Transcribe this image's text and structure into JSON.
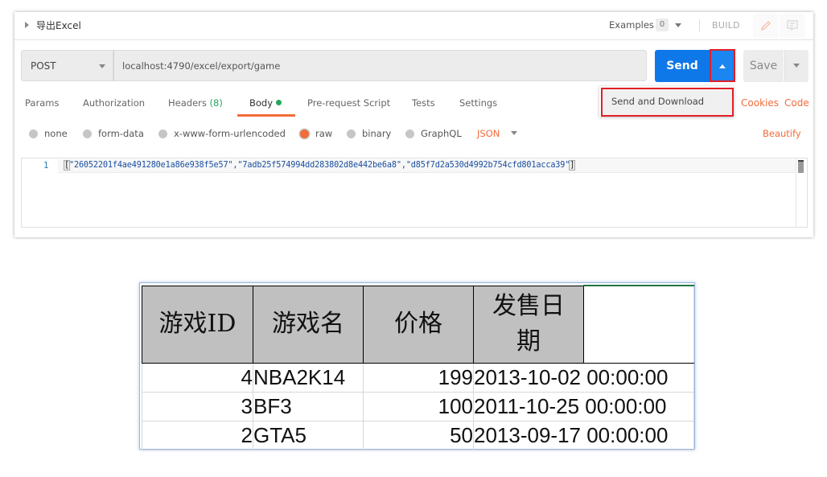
{
  "request": {
    "name": "导出Excel",
    "examples_label": "Examples",
    "examples_count": "0",
    "build_label": "BUILD",
    "method": "POST",
    "url": "localhost:4790/excel/export/game",
    "send_label": "Send",
    "save_label": "Save",
    "dropdown_item": "Send and Download"
  },
  "tabs": [
    {
      "label": "Params"
    },
    {
      "label": "Authorization"
    },
    {
      "label": "Headers",
      "count": "(8)"
    },
    {
      "label": "Body",
      "active": true
    },
    {
      "label": "Pre-request Script"
    },
    {
      "label": "Tests"
    },
    {
      "label": "Settings"
    }
  ],
  "links": {
    "cookies": "Cookies",
    "code": "Code",
    "beautify": "Beautify"
  },
  "body_types": [
    {
      "label": "none",
      "selected": false
    },
    {
      "label": "form-data",
      "selected": false
    },
    {
      "label": "x-www-form-urlencoded",
      "selected": false
    },
    {
      "label": "raw",
      "selected": true
    },
    {
      "label": "binary",
      "selected": false
    },
    {
      "label": "GraphQL",
      "selected": false
    }
  ],
  "format": "JSON",
  "editor": {
    "line_number": "1",
    "open_bracket": "[",
    "content": "\"26052201f4ae491280e1a86e938f5e57\",\"7adb25f574994dd283802d8e442be6a8\",\"d85f7d2a530d4992b754cfd801acca39\"",
    "close_bracket": "]"
  },
  "spreadsheet": {
    "headers": [
      "游戏ID",
      "游戏名",
      "价格",
      "发售日期"
    ],
    "rows": [
      {
        "id": "4",
        "name": "NBA2K14",
        "price": "199",
        "date": "2013-10-02 00:00:00"
      },
      {
        "id": "3",
        "name": "BF3",
        "price": "100",
        "date": "2011-10-25 00:00:00"
      },
      {
        "id": "2",
        "name": "GTA5",
        "price": "50",
        "date": "2013-09-17 00:00:00"
      }
    ]
  },
  "colors": {
    "send_blue": "#0f78e8",
    "accent_orange": "#f26b3a",
    "highlight_red": "#e21f26",
    "success_green": "#26a65b",
    "excel_header_gray": "#c0c0c0"
  }
}
